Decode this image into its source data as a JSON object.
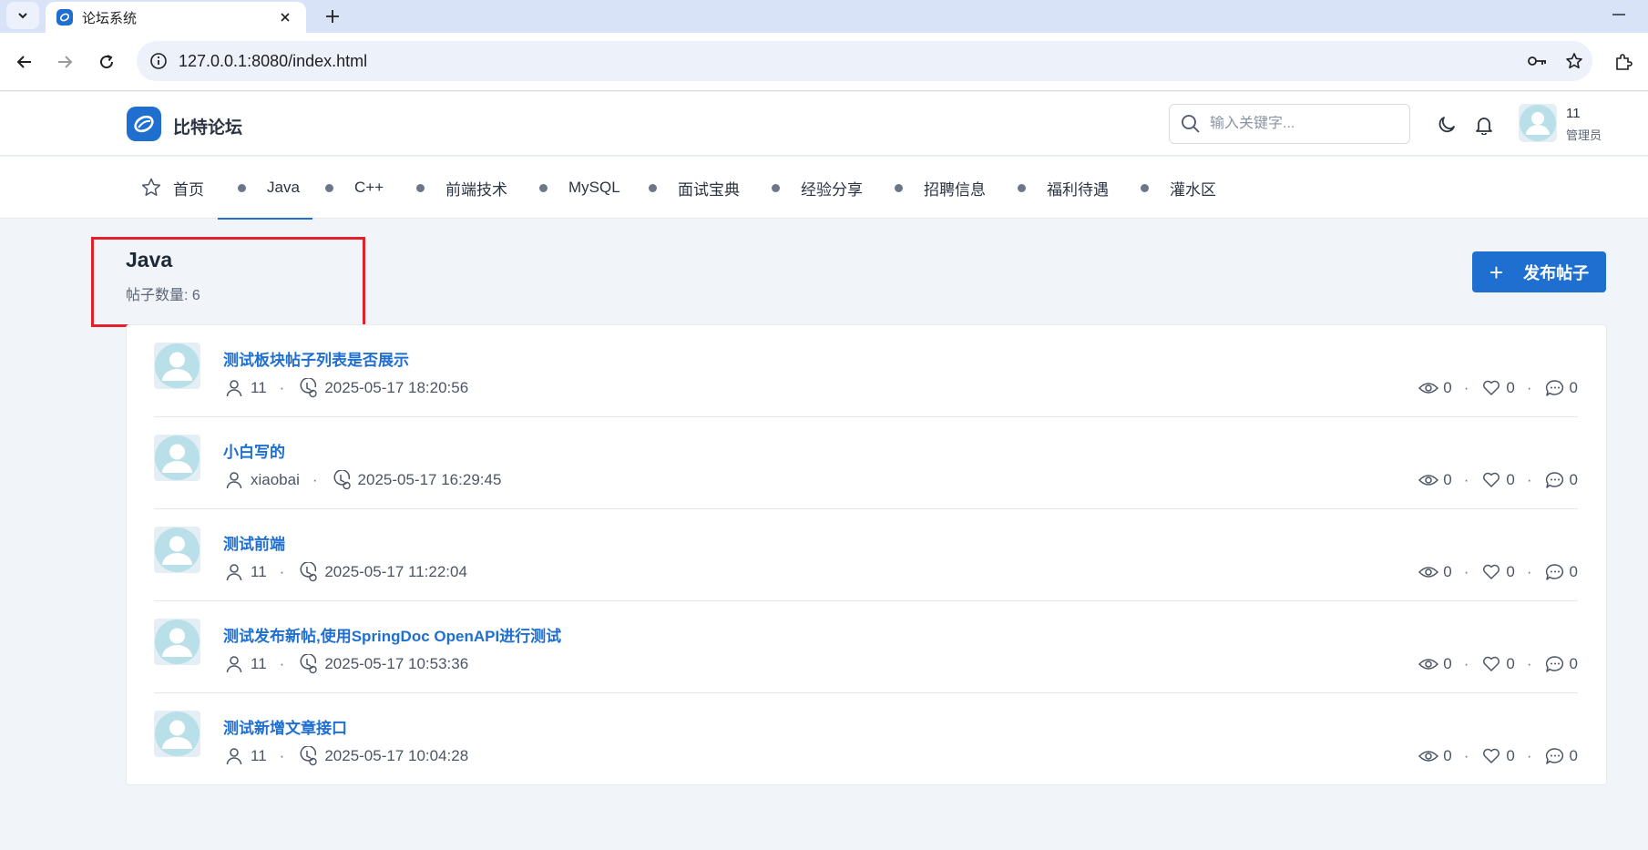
{
  "browser": {
    "tab_title": "论坛系统",
    "url_host": "127.0.0.1",
    "url_rest": ":8080/index.html"
  },
  "site": {
    "name": "比特论坛",
    "search_placeholder": "输入关键字...",
    "user": {
      "name": "11",
      "role": "管理员"
    }
  },
  "nav": {
    "home": "首页",
    "categories": [
      "Java",
      "C++",
      "前端技术",
      "MySQL",
      "面试宝典",
      "经验分享",
      "招聘信息",
      "福利待遇",
      "灌水区"
    ],
    "active": "Java"
  },
  "board": {
    "title": "Java",
    "count_label": "帖子数量: 6",
    "publish_label": "发布帖子"
  },
  "posts": [
    {
      "title": "测试板块帖子列表是否展示",
      "author": "11",
      "time": "2025-05-17 18:20:56",
      "views": "0",
      "likes": "0",
      "comments": "0"
    },
    {
      "title": "小白写的",
      "author": "xiaobai",
      "time": "2025-05-17 16:29:45",
      "views": "0",
      "likes": "0",
      "comments": "0"
    },
    {
      "title": "测试前端",
      "author": "11",
      "time": "2025-05-17 11:22:04",
      "views": "0",
      "likes": "0",
      "comments": "0"
    },
    {
      "title": "测试发布新帖,使用SpringDoc OpenAPI进行测试",
      "author": "11",
      "time": "2025-05-17 10:53:36",
      "views": "0",
      "likes": "0",
      "comments": "0"
    },
    {
      "title": "测试新增文章接口",
      "author": "11",
      "time": "2025-05-17 10:04:28",
      "views": "0",
      "likes": "0",
      "comments": "0"
    }
  ],
  "colors": {
    "accent": "#1f6fd0",
    "highlight": "#e4212b",
    "page_bg": "#f1f4f8"
  }
}
